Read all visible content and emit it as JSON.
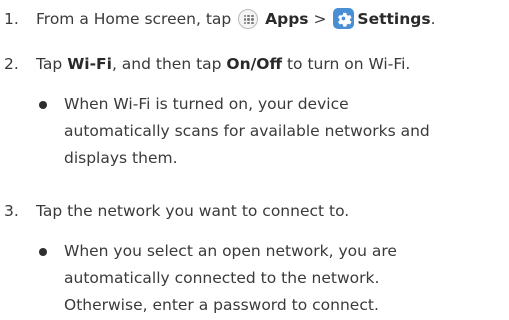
{
  "steps": [
    {
      "number": "1.",
      "pre": "From a Home screen, tap",
      "apps_label": "Apps",
      "separator": ">",
      "settings_label": "Settings",
      "end": "."
    },
    {
      "number": "2.",
      "pre": "Tap",
      "wifi_label": "Wi-Fi",
      "mid": ", and then tap",
      "onoff_label": "On/Off",
      "post": "to turn on Wi-Fi.",
      "bullet_line1": "When Wi-Fi is turned on, your device",
      "bullet_line2": "automatically scans for available networks and",
      "bullet_line3": "displays them."
    },
    {
      "number": "3.",
      "text": "Tap the network you want to connect to.",
      "bullet_line1": "When you select an open network, you are",
      "bullet_line2": "automatically connected to the network.",
      "bullet_line3": "Otherwise, enter a password to connect."
    }
  ],
  "icons": {
    "apps": "apps-grid-icon",
    "settings": "settings-gear-icon",
    "settings_color": "#4a8fd6"
  }
}
